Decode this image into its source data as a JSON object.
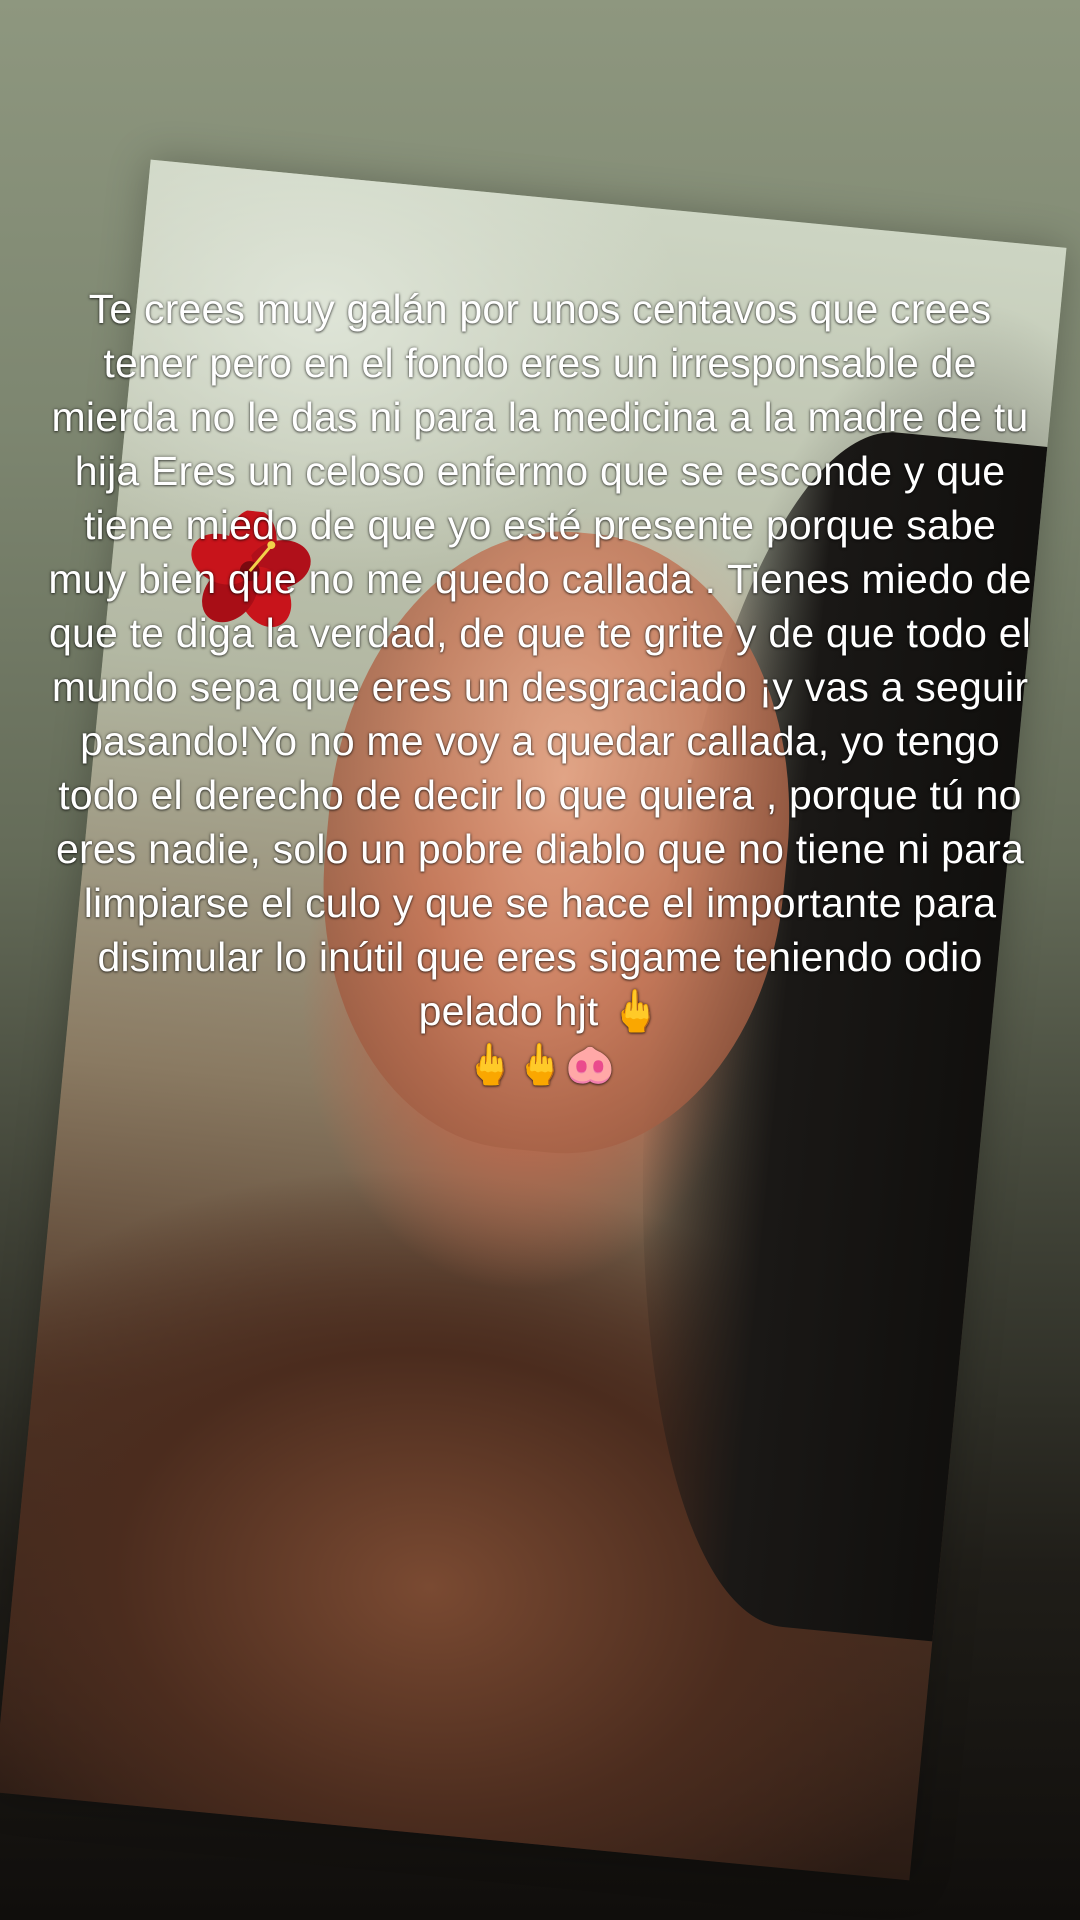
{
  "post": {
    "caption": "Te crees muy galán por unos centavos que crees tener pero en el fondo eres un irresponsable de mierda no le das ni  para la medicina a la madre de tu hija Eres un celoso enfermo que se esconde y que tiene miedo de que yo esté presente porque sabe muy bien que no me quedo callada . Tienes miedo de que te diga la verdad, de que te grite y de que todo el mundo sepa que eres un desgraciado ¡y vas a seguir pasando!Yo no me voy a quedar callada, yo tengo todo el derecho de decir lo que quiera , porque tú no eres nadie, solo un pobre diablo que no tiene ni para limpiarse el culo y que se hace el importante para disimular lo inútil que eres sigame teniendo odio pelado hjt 🖕",
    "emoji_tail": "🖕🖕🐽"
  },
  "colors": {
    "background_top": "#8e977f",
    "background_bottom": "#100e0c",
    "text": "#ffffff",
    "flower": "#c8141b"
  },
  "icons": {
    "flower": "hibiscus-flower-icon"
  }
}
